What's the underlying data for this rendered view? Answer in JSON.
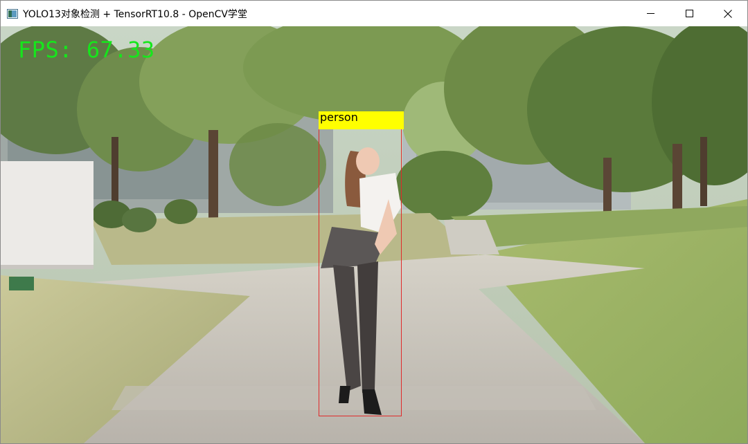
{
  "window": {
    "title": "YOLO13对象检测 + TensorRT10.8 - OpenCV学堂",
    "icon": "app-window-icon",
    "controls": [
      "minimize-icon",
      "maximize-icon",
      "close-icon"
    ]
  },
  "overlay": {
    "fps_text": "FPS: 67.33",
    "fps_color": "#16e61c"
  },
  "detections": [
    {
      "label": "person",
      "box_color": "#e02a2a",
      "label_bg": "#ffff00"
    }
  ]
}
